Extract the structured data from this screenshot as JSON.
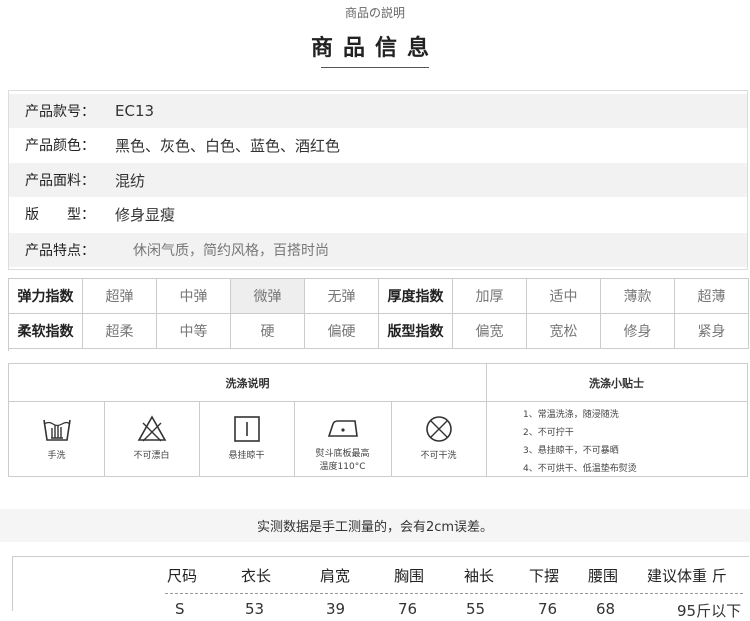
{
  "header": {
    "subtitle": "商品の説明",
    "title": "商品信息"
  },
  "info": [
    {
      "label": "产品款号：",
      "value": "EC13"
    },
    {
      "label": "产品颜色：",
      "value": "黑色、灰色、白色、蓝色、酒红色"
    },
    {
      "label": "产品面料：",
      "value": "混纺"
    },
    {
      "label": "版　　型：",
      "value": "修身显瘦"
    },
    {
      "label": "产品特点：",
      "value": "休闲气质，简约风格，百搭时尚"
    }
  ],
  "indices": {
    "rows": [
      {
        "a_label": "弹力指数",
        "a_options": [
          "超弹",
          "中弹",
          "微弹",
          "无弹"
        ],
        "a_selected": 2,
        "b_label": "厚度指数",
        "b_options": [
          "加厚",
          "适中",
          "薄款",
          "超薄"
        ],
        "b_selected": -1
      },
      {
        "a_label": "柔软指数",
        "a_options": [
          "超柔",
          "中等",
          "硬",
          "偏硬"
        ],
        "a_selected": -1,
        "b_label": "版型指数",
        "b_options": [
          "偏宽",
          "宽松",
          "修身",
          "紧身"
        ],
        "b_selected": -1
      }
    ]
  },
  "wash": {
    "title": "洗涤说明",
    "tips_title": "洗涤小贴士",
    "items": [
      {
        "icon": "hand-wash-icon",
        "label": "手洗"
      },
      {
        "icon": "no-bleach-icon",
        "label": "不可漂白"
      },
      {
        "icon": "hang-dry-icon",
        "label": "悬挂晾干"
      },
      {
        "icon": "iron-icon",
        "label": "熨斗底板最高",
        "label2": "温度110°C"
      },
      {
        "icon": "no-dry-clean-icon",
        "label": "不可干洗"
      }
    ],
    "tips": [
      "1、常温洗涤，随浸随洗",
      "2、不可拧干",
      "3、悬挂晾干，不可暴晒",
      "4、不可烘干、低温垫布熨烫"
    ]
  },
  "note": "实测数据是手工测量的，会有2cm误差。",
  "size_table": {
    "headers": [
      "尺码",
      "衣长",
      "肩宽",
      "胸围",
      "袖长",
      "下摆",
      "腰围",
      "建议体重 斤"
    ],
    "row": [
      "S",
      "53",
      "39",
      "76",
      "55",
      "76",
      "68",
      "95斤以下"
    ]
  }
}
